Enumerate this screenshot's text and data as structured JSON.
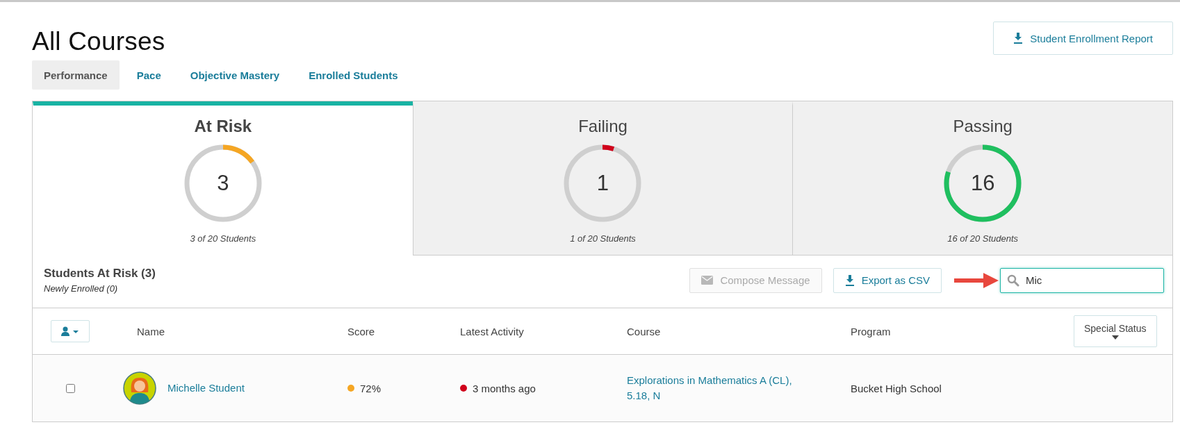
{
  "page": {
    "title": "All Courses"
  },
  "report_button": {
    "label": "Student Enrollment Report"
  },
  "tabs": [
    {
      "label": "Performance",
      "selected": true
    },
    {
      "label": "Pace",
      "selected": false
    },
    {
      "label": "Objective Mastery",
      "selected": false
    },
    {
      "label": "Enrolled Students",
      "selected": false
    }
  ],
  "summary_cards": [
    {
      "title": "At Risk",
      "count": "3",
      "caption": "3 of 20 Students",
      "level": 0.15,
      "color": "#f5a623",
      "selected": true
    },
    {
      "title": "Failing",
      "count": "1",
      "caption": "1 of 20 Students",
      "level": 0.05,
      "color": "#d0021b",
      "selected": false
    },
    {
      "title": "Passing",
      "count": "16",
      "caption": "16 of 20 Students",
      "level": 0.8,
      "color": "#1fbf5f",
      "selected": false
    }
  ],
  "students_section": {
    "title": "Students At Risk (3)",
    "subtitle": "Newly Enrolled (0)",
    "compose_button": {
      "label": "Compose Message",
      "disabled": true
    },
    "export_button": {
      "label": "Export as CSV"
    },
    "search": {
      "value": "Mic"
    }
  },
  "table": {
    "columns": [
      "Name",
      "Score",
      "Latest Activity",
      "Course",
      "Program"
    ],
    "special_status": "Special Status",
    "rows": [
      {
        "checked": false,
        "name": "Michelle Student",
        "score": {
          "text": "72%",
          "color": "#f5a623"
        },
        "activity": {
          "text": "3 months ago",
          "color": "#d0021b"
        },
        "course": "Explorations in Mathematics A (CL), 5.18, N",
        "program": "Bucket High School"
      }
    ]
  }
}
